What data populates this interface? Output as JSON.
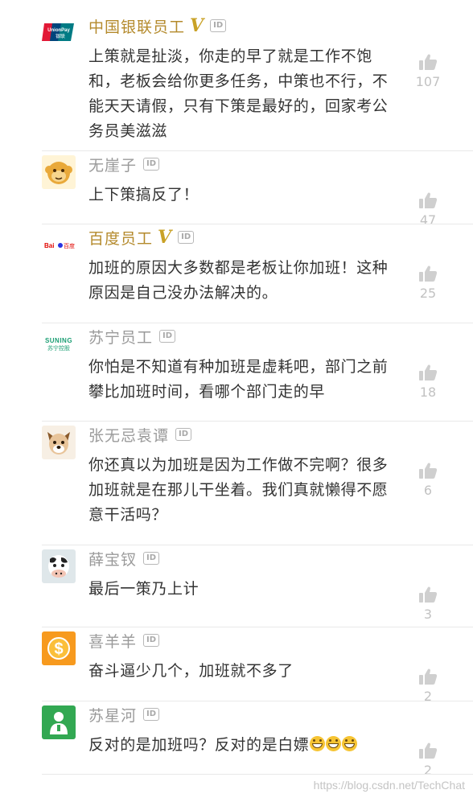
{
  "comments": [
    {
      "name": "中国银联员工",
      "verified": true,
      "id_badge": "ID",
      "avatar": "unionpay-logo-avatar",
      "avatar_text": "UnionPay 银联",
      "lines": [
        "上策就是扯淡，你走的早了就是工作不饱",
        "和，老板会给你更多任务，中策也不行，不",
        "能天天请假，只有下策是最好的，回家考公",
        "务员美滋滋"
      ],
      "likes": "107"
    },
    {
      "name": "无崖子",
      "verified": false,
      "id_badge": "ID",
      "avatar": "monkey-avatar",
      "lines": [
        "上下策搞反了！"
      ],
      "likes": "47"
    },
    {
      "name": "百度员工",
      "verified": true,
      "id_badge": "ID",
      "avatar": "baidu-logo-avatar",
      "avatar_text": "Bai 百度",
      "lines": [
        "加班的原因大多数都是老板让你加班！这种",
        "原因是自己没办法解决的。"
      ],
      "likes": "25"
    },
    {
      "name": "苏宁员工",
      "verified": false,
      "id_badge": "ID",
      "avatar": "suning-logo-avatar",
      "avatar_text_1": "SUNING",
      "avatar_text_2": "苏宁控股",
      "lines": [
        "你怕是不知道有种加班是虚耗吧，部门之前",
        "攀比加班时间，看哪个部门走的早"
      ],
      "likes": "18"
    },
    {
      "name": "张无忌袁谭",
      "verified": false,
      "id_badge": "ID",
      "avatar": "dog-avatar",
      "lines": [
        "你还真以为加班是因为工作做不完啊？很多",
        "加班就是在那儿干坐着。我们真就懒得不愿",
        "意干活吗？"
      ],
      "likes": "6"
    },
    {
      "name": "薛宝钗",
      "verified": false,
      "id_badge": "ID",
      "avatar": "cow-avatar",
      "lines": [
        "最后一策乃上计"
      ],
      "likes": "3"
    },
    {
      "name": "喜羊羊",
      "verified": false,
      "id_badge": "ID",
      "avatar": "dollar-coin-avatar",
      "lines": [
        "奋斗逼少几个，加班就不多了"
      ],
      "likes": "2"
    },
    {
      "name": "苏星河",
      "verified": false,
      "id_badge": "ID",
      "avatar": "person-avatar",
      "lines": [
        "反对的是加班吗？反对的是白嫖"
      ],
      "emoji_count": 3,
      "emoji": "grinning-face",
      "likes": "2"
    }
  ],
  "watermark": "https://blog.csdn.net/TechChat",
  "colors": {
    "verified_name": "#b48a2c",
    "v_badge": "#c9a227",
    "normal_name": "#9a9a9a",
    "text": "#333333",
    "like": "#c2c2c2"
  }
}
